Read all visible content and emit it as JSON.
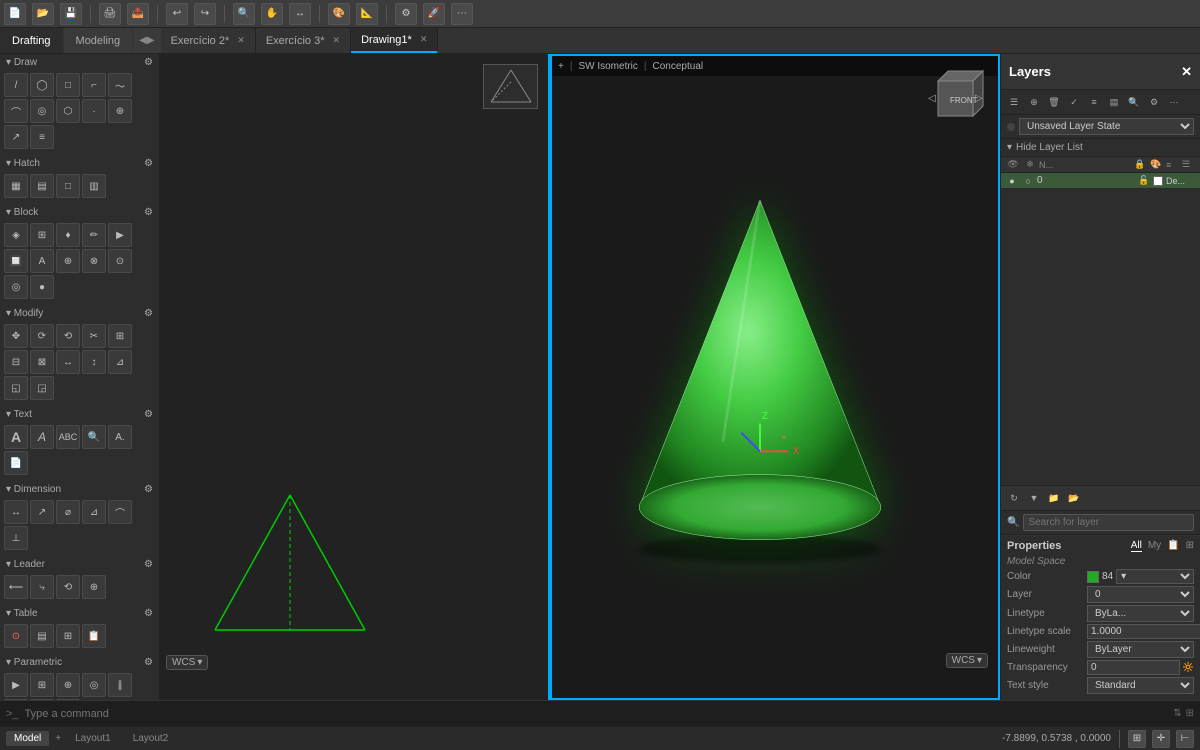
{
  "topToolbar": {
    "buttons": [
      "⏎",
      "📄",
      "💾",
      "✂",
      "📋",
      "↩",
      "↪",
      "🖨",
      "📤",
      "📥",
      "🔲",
      "✋",
      "↔",
      "📐",
      "🔍",
      "📊",
      "🏷",
      "⚙",
      "🚀"
    ]
  },
  "workspaceTabs": {
    "tabs": [
      "Drafting",
      "Modeling"
    ],
    "active": "Drafting",
    "collapse": "◀▶"
  },
  "fileTabs": [
    {
      "label": "Exercício 2*",
      "active": false
    },
    {
      "label": "Exercício 3*",
      "active": false
    },
    {
      "label": "Drawing1*",
      "active": true
    }
  ],
  "viewports": {
    "left": {
      "wcs": "WCS",
      "wcs_icon": "⊞"
    },
    "right": {
      "breadcrumb": "+",
      "view1": "SW Isometric",
      "view2": "Conceptual",
      "wcs": "WCS"
    }
  },
  "leftPanel": {
    "sections": [
      {
        "name": "Draw",
        "tools": [
          "╱",
          "◯",
          "□",
          "↗",
          "～",
          "⊕",
          "△",
          "⬡",
          "⊞",
          "⋯",
          "⌒",
          "⌐"
        ]
      },
      {
        "name": "Hatch",
        "tools": [
          "▦",
          "▤",
          "▥",
          "□"
        ]
      },
      {
        "name": "Block",
        "tools": [
          "◈",
          "⊞",
          "♦",
          "✏",
          "▶",
          "🔲",
          "⊕",
          "⊗",
          "⊙",
          "◎",
          "⊛",
          "●"
        ]
      },
      {
        "name": "Modify",
        "tools": [
          "✥",
          "⟳",
          "⟲",
          "✂",
          "⊞",
          "⊟",
          "⊠",
          "↔",
          "↕",
          "⊿",
          "◱",
          "◲"
        ]
      },
      {
        "name": "Text",
        "tools": [
          "A",
          "𝐴",
          "A.",
          "📋",
          "📄",
          "🔍",
          "A"
        ]
      },
      {
        "name": "Dimension",
        "tools": [
          "↔",
          "↕",
          "⌀",
          "⊿",
          "╱",
          "↗"
        ]
      },
      {
        "name": "Leader",
        "tools": [
          "⟵",
          "⤷",
          "⟲",
          "⊕"
        ]
      },
      {
        "name": "Table",
        "tools": [
          "⊙",
          "▤",
          "⊞",
          "📋"
        ]
      },
      {
        "name": "Parametric",
        "tools": [
          "▶",
          "⊞",
          "⊕",
          "⊗",
          "≡",
          "∥",
          "⊥",
          "⌂"
        ]
      }
    ]
  },
  "layersPanel": {
    "title": "Layers",
    "layerState": "Unsaved Layer State",
    "hideLayerList": "Hide Layer List",
    "searchPlaceholder": "Search for layer",
    "layers": [
      {
        "name": "0",
        "color": "white",
        "description": "De...",
        "active": true
      }
    ],
    "colHeaders": [
      "👁",
      "N...",
      "🔒",
      "🎨",
      "≡",
      "☰"
    ]
  },
  "properties": {
    "title": "Properties",
    "tabs": [
      "All",
      "My"
    ],
    "section": "Model Space",
    "fields": [
      {
        "label": "Color",
        "value": "84",
        "type": "color"
      },
      {
        "label": "Layer",
        "value": "0",
        "type": "text"
      },
      {
        "label": "Linetype",
        "value": "ByLa...",
        "type": "select"
      },
      {
        "label": "Linetype scale",
        "value": "1.0000",
        "type": "text"
      },
      {
        "label": "Lineweight",
        "value": "ByLayer",
        "type": "select"
      },
      {
        "label": "Transparency",
        "value": "0",
        "type": "text"
      },
      {
        "label": "Text style",
        "value": "Standard",
        "type": "select"
      }
    ]
  },
  "statusBar": {
    "tabs": [
      "Model",
      "Layout1",
      "Layout2"
    ],
    "activeTab": "Model",
    "coords": "-7.8899, 0.5738 , 0.0000",
    "addTab": "+"
  },
  "commandBar": {
    "prompt": ">_",
    "placeholder": "Type a command"
  }
}
